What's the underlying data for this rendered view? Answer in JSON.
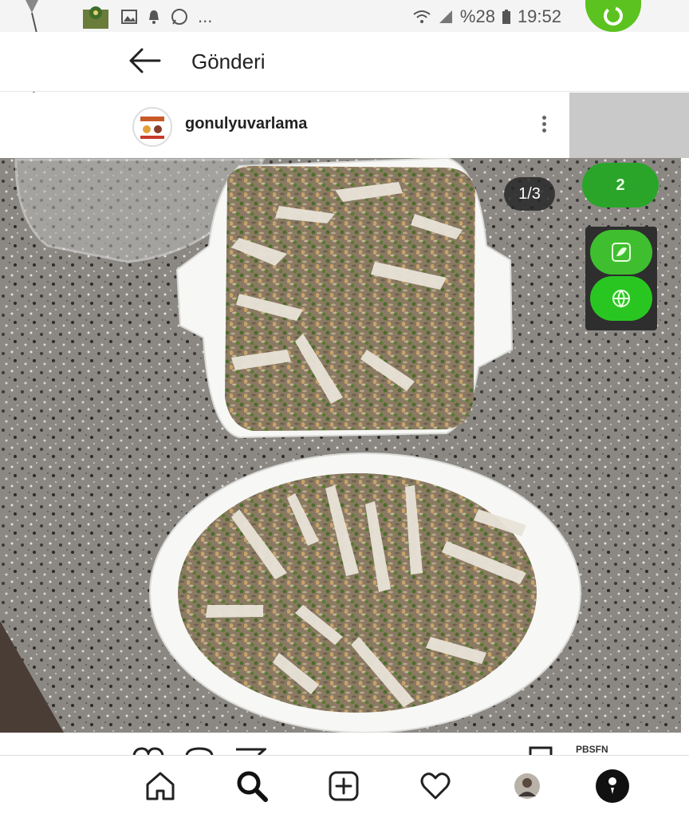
{
  "status_bar": {
    "battery": "%28",
    "time": "19:52",
    "more": "..."
  },
  "header": {
    "title": "Gönderi"
  },
  "post": {
    "username": "gonulyuvarlama",
    "image_counter": "1/3",
    "image_description": "Two white baking dishes of rice topped with shredded chicken, green pistachios and almonds on a granite counter"
  },
  "overlays": {
    "pill_label": "2"
  },
  "action_row": {
    "partial_label": "PBSFN"
  },
  "colors": {
    "accent_green": "#5cc21f",
    "text_primary": "#222222",
    "counter_bg": "#282828"
  },
  "bottom_nav": {
    "items": [
      "home-icon",
      "search-icon",
      "add-post-icon",
      "heart-icon",
      "profile-avatar",
      "account-icon"
    ]
  }
}
